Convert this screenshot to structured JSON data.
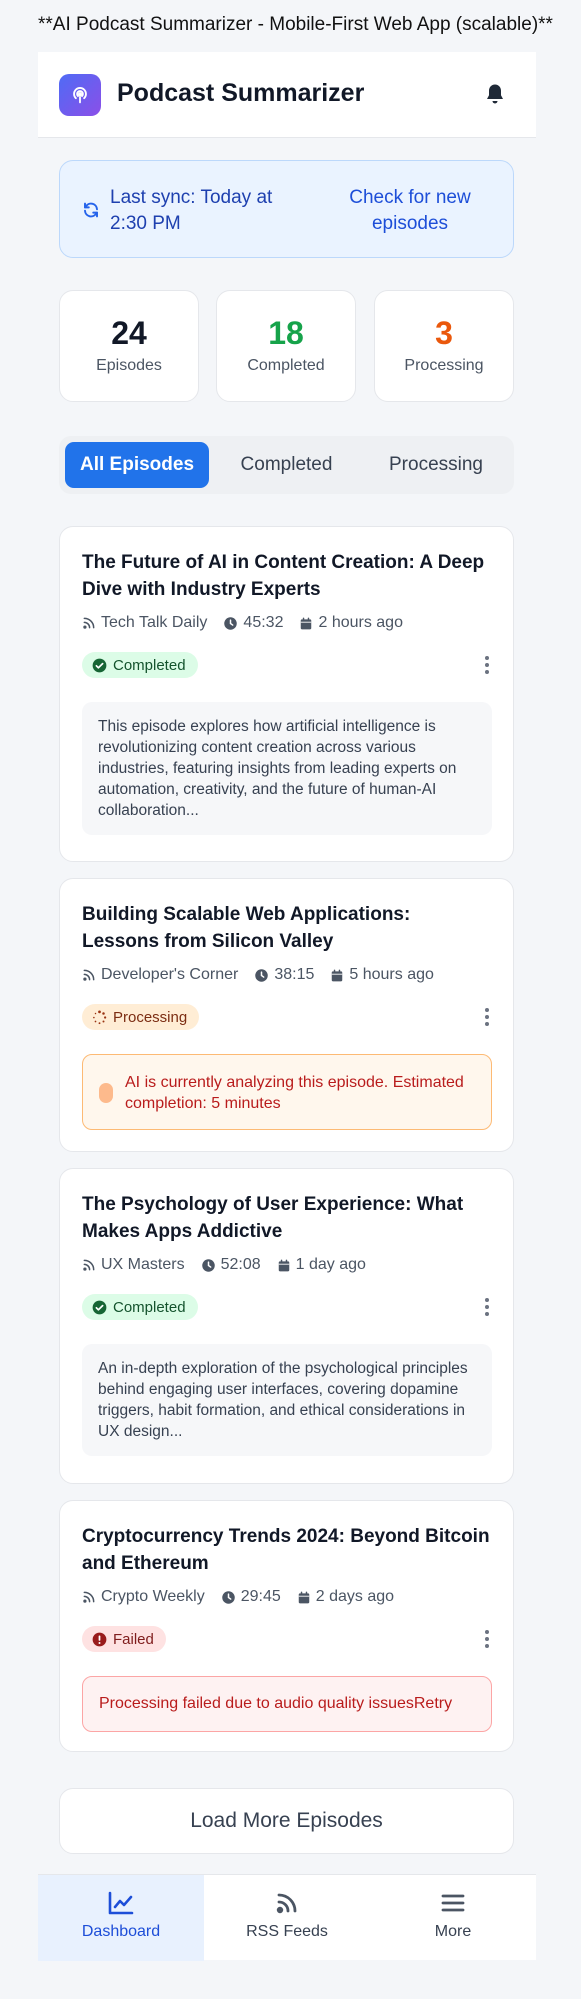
{
  "page_title": "**AI Podcast Summarizer - Mobile-First Web App (scalable)**",
  "header": {
    "title": "Podcast Summarizer",
    "logo_icon": "podcast-icon",
    "notification_icon": "bell-icon"
  },
  "sync": {
    "text": "Last sync: Today at 2:30 PM",
    "action": "Check for new episodes"
  },
  "stats": [
    {
      "value": "24",
      "label": "Episodes",
      "color": "#111827"
    },
    {
      "value": "18",
      "label": "Completed",
      "color": "#16a34a"
    },
    {
      "value": "3",
      "label": "Processing",
      "color": "#ea580c"
    }
  ],
  "tabs": [
    {
      "label": "All Episodes",
      "active": true
    },
    {
      "label": "Completed",
      "active": false
    },
    {
      "label": "Processing",
      "active": false
    }
  ],
  "episodes": [
    {
      "title": "The Future of AI in Content Creation: A Deep Dive with Industry Experts",
      "feed": "Tech Talk Daily",
      "duration": "45:32",
      "date": "2 hours ago",
      "status": "Completed",
      "summary": "This episode explores how artificial intelligence is revolutionizing content creation across various industries, featuring insights from leading experts on automation, creativity, and the future of human-AI collaboration..."
    },
    {
      "title": "Building Scalable Web Applications: Lessons from Silicon Valley",
      "feed": "Developer's Corner",
      "duration": "38:15",
      "date": "5 hours ago",
      "status": "Processing",
      "message": "AI is currently analyzing this episode. Estimated completion: 5 minutes"
    },
    {
      "title": "The Psychology of User Experience: What Makes Apps Addictive",
      "feed": "UX Masters",
      "duration": "52:08",
      "date": "1 day ago",
      "status": "Completed",
      "summary": "An in-depth exploration of the psychological principles behind engaging user interfaces, covering dopamine triggers, habit formation, and ethical considerations in UX design..."
    },
    {
      "title": "Cryptocurrency Trends 2024: Beyond Bitcoin and Ethereum",
      "feed": "Crypto Weekly",
      "duration": "29:45",
      "date": "2 days ago",
      "status": "Failed",
      "message": "Processing failed due to audio quality issues",
      "retry_label": "Retry"
    }
  ],
  "load_more": "Load More Episodes",
  "bottom_nav": [
    {
      "label": "Dashboard",
      "icon": "chart-line-icon",
      "active": true
    },
    {
      "label": "RSS Feeds",
      "icon": "rss-icon",
      "active": false
    },
    {
      "label": "More",
      "icon": "menu-icon",
      "active": false
    }
  ],
  "colors": {
    "accent": "#2173ea",
    "completed": "#16a34a",
    "processing": "#ea580c",
    "failed": "#dc2626"
  }
}
